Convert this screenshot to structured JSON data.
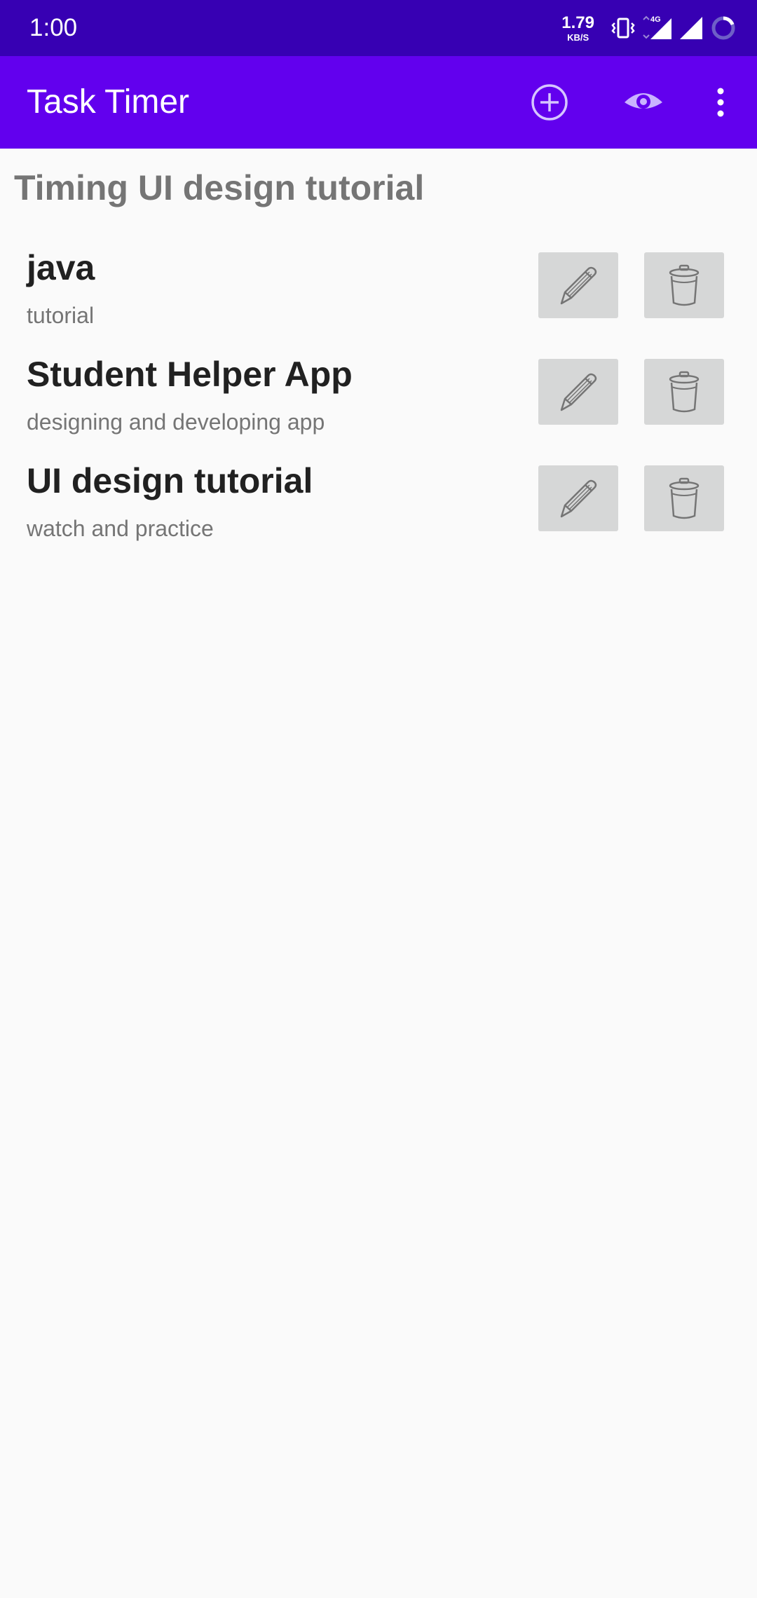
{
  "status_bar": {
    "time": "1:00",
    "net_speed": "1.79",
    "net_unit": "KB/S",
    "network_type": "4G"
  },
  "app_bar": {
    "title": "Task Timer",
    "actions": [
      "plus-circle-icon",
      "eye-icon",
      "more-vert-icon"
    ]
  },
  "main": {
    "heading": "Timing UI design tutorial",
    "tasks": [
      {
        "name": "java",
        "description": "tutorial"
      },
      {
        "name": "Student Helper App",
        "description": "designing and developing app"
      },
      {
        "name": "UI design tutorial",
        "description": "watch and practice"
      }
    ]
  },
  "colors": {
    "status_bar": "#3700b3",
    "app_bar": "#6200ee",
    "background": "#fafafa",
    "button_bg": "#d6d7d7"
  }
}
